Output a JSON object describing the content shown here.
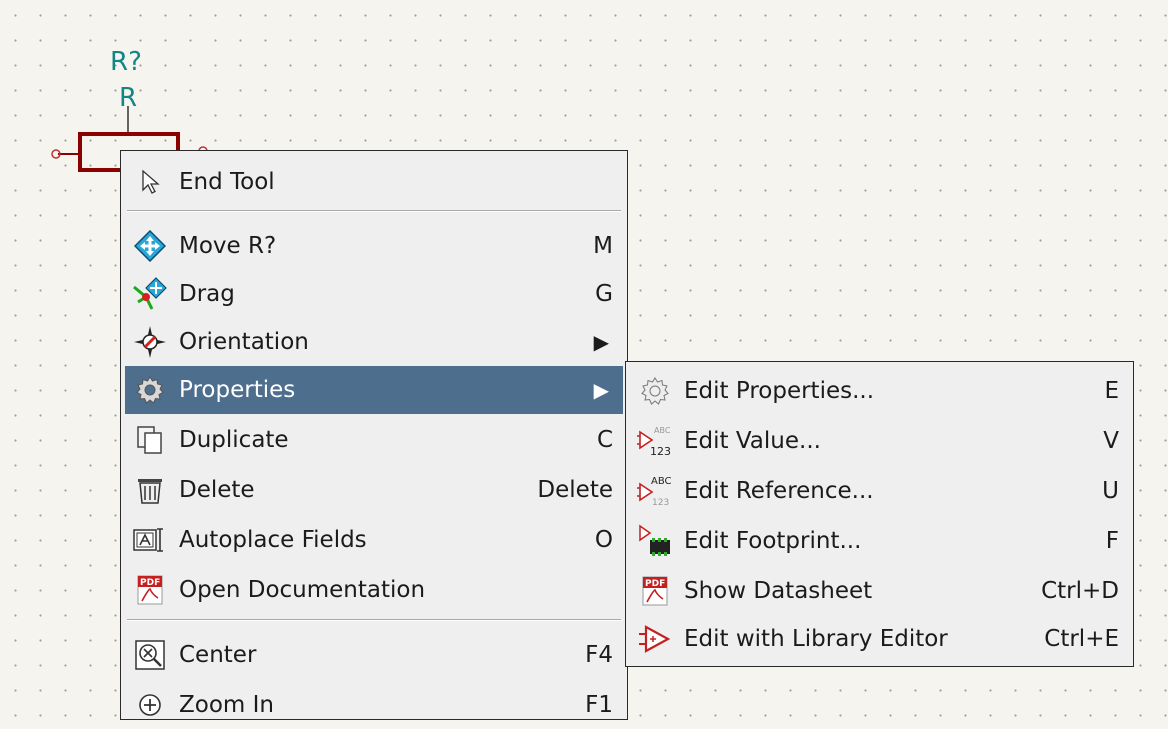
{
  "symbol": {
    "reference": "R?",
    "value": "R"
  },
  "context_menu": {
    "items": [
      {
        "label": "End Tool",
        "shortcut": ""
      },
      {
        "label": "Move R?",
        "shortcut": "M"
      },
      {
        "label": "Drag",
        "shortcut": "G"
      },
      {
        "label": "Orientation",
        "shortcut": ""
      },
      {
        "label": "Properties",
        "shortcut": ""
      },
      {
        "label": "Duplicate",
        "shortcut": "C"
      },
      {
        "label": "Delete",
        "shortcut": "Delete"
      },
      {
        "label": "Autoplace Fields",
        "shortcut": "O"
      },
      {
        "label": "Open Documentation",
        "shortcut": ""
      },
      {
        "label": "Center",
        "shortcut": "F4"
      },
      {
        "label": "Zoom In",
        "shortcut": "F1"
      }
    ]
  },
  "properties_submenu": {
    "items": [
      {
        "label": "Edit Properties...",
        "shortcut": "E"
      },
      {
        "label": "Edit Value...",
        "shortcut": "V"
      },
      {
        "label": "Edit Reference...",
        "shortcut": "U"
      },
      {
        "label": "Edit Footprint...",
        "shortcut": "F"
      },
      {
        "label": "Show Datasheet",
        "shortcut": "Ctrl+D"
      },
      {
        "label": "Edit with Library Editor",
        "shortcut": "Ctrl+E"
      }
    ]
  },
  "icon_text": {
    "pdf": "PDF",
    "abc": "ABC",
    "num": "123"
  },
  "colors": {
    "selection": "#4e6e8e",
    "symbol": "#8b0000",
    "field_text": "#138585"
  }
}
